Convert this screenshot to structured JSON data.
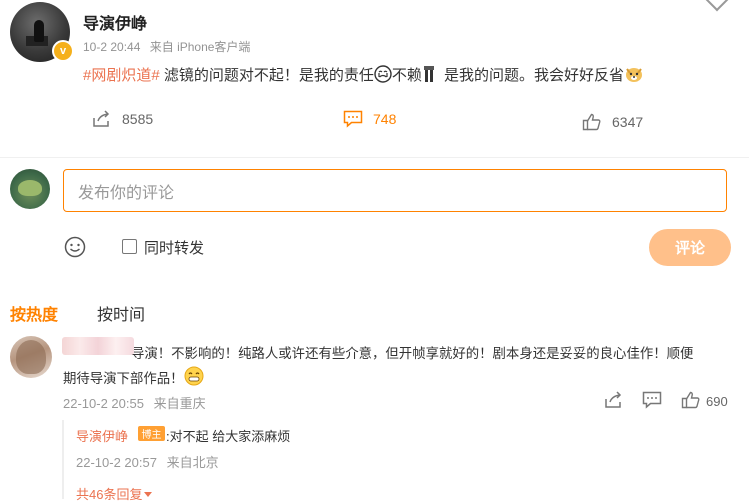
{
  "post": {
    "author": "导演伊峥",
    "time": "10-2 20:44",
    "source": "来自 iPhone客户端",
    "topic": "#网剧炽道#",
    "text_a": " 滤镜的问题对不起！是我的责任",
    "text_b": "不赖",
    "text_c": " 是我的问题。我会好好反省"
  },
  "actions": {
    "repost_count": "8585",
    "comment_count": "748",
    "like_count": "6347"
  },
  "composer": {
    "placeholder": "发布你的评论",
    "repost_label": "同时转发",
    "submit_label": "评论"
  },
  "sort": {
    "hot": "按热度",
    "time": "按时间"
  },
  "comment": {
    "text_line1": "导演！不影响的！纯路人或许还有些介意，但开帧享就好的！剧本身还是妥妥的良心佳作！顺便",
    "text_line2": "期待导演下部作品！",
    "time": "22-10-2 20:55",
    "source": "来自重庆",
    "like_count": "690"
  },
  "reply": {
    "author": "导演伊峥",
    "badge": "博主",
    "text": ":对不起 给大家添麻烦",
    "time": "22-10-2 20:57",
    "source": "来自北京",
    "more": "共46条回复"
  },
  "colors": {
    "accent": "#ff8200",
    "topic": "#eb7350",
    "meta": "#999999"
  }
}
